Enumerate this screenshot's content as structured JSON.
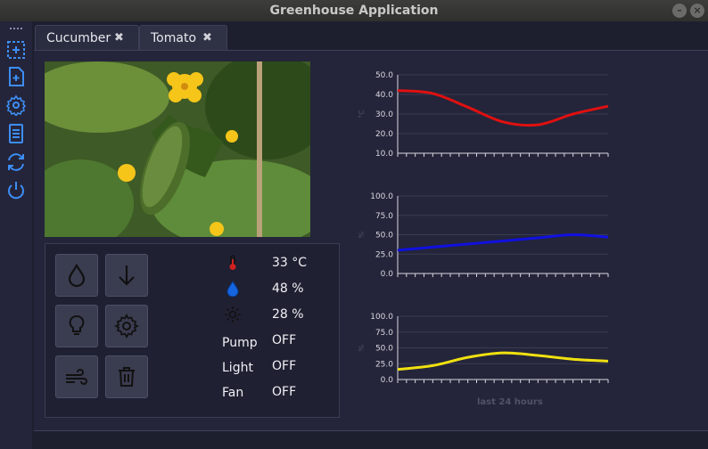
{
  "window": {
    "title": "Greenhouse Application",
    "minimize_glyph": "–",
    "close_glyph": "×"
  },
  "toolbar": {
    "items": [
      {
        "name": "select-area-icon"
      },
      {
        "name": "add-file-icon"
      },
      {
        "name": "settings-icon"
      },
      {
        "name": "document-icon"
      },
      {
        "name": "sync-icon"
      },
      {
        "name": "power-icon"
      }
    ],
    "icon_color": "#3d8ef5"
  },
  "tabs": [
    {
      "label": "Cucumber",
      "close": "✖"
    },
    {
      "label": "Tomato",
      "close": "✖"
    }
  ],
  "controls": {
    "buttons": [
      {
        "name": "water-drop-button",
        "icon": "water-drop-icon"
      },
      {
        "name": "down-arrow-button",
        "icon": "arrow-down-icon"
      },
      {
        "name": "light-bulb-button",
        "icon": "light-bulb-icon"
      },
      {
        "name": "settings-button",
        "icon": "gear-icon"
      },
      {
        "name": "fan-button",
        "icon": "wind-icon"
      },
      {
        "name": "delete-button",
        "icon": "trash-icon"
      }
    ]
  },
  "sensors": {
    "temperature": "33 °C",
    "humidity": "48 %",
    "light_level": "28 %"
  },
  "devices": {
    "pump_label": "Pump",
    "pump_state": "OFF",
    "light_label": "Light",
    "light_state": "OFF",
    "fan_label": "Fan",
    "fan_state": "OFF"
  },
  "chart_data": [
    {
      "type": "line",
      "ylabel": "°C",
      "ylim": [
        10.0,
        50.0
      ],
      "yticks": [
        "50.0",
        "40.0",
        "30.0",
        "20.0",
        "10.0"
      ],
      "x": [
        0,
        4,
        8,
        12,
        16,
        20,
        24
      ],
      "series": [
        {
          "values": [
            42.0,
            40.5,
            33.5,
            26.0,
            24.5,
            30.0,
            34.0
          ],
          "color": "#e01010"
        }
      ]
    },
    {
      "type": "line",
      "ylabel": "%",
      "ylim": [
        0.0,
        100.0
      ],
      "yticks": [
        "100.0",
        "75.0",
        "50.0",
        "25.0",
        "0.0"
      ],
      "x": [
        0,
        4,
        8,
        12,
        16,
        20,
        24
      ],
      "series": [
        {
          "values": [
            30,
            34,
            38,
            42,
            46,
            50,
            47
          ],
          "color": "#1010e0"
        }
      ]
    },
    {
      "type": "line",
      "ylabel": "%",
      "ylim": [
        0.0,
        100.0
      ],
      "yticks": [
        "100.0",
        "75.0",
        "50.0",
        "25.0",
        "0.0"
      ],
      "x": [
        0,
        4,
        8,
        12,
        16,
        20,
        24
      ],
      "xlabel": "last 24 hours",
      "series": [
        {
          "values": [
            16,
            22,
            35,
            42,
            38,
            32,
            29
          ],
          "color": "#f0e010"
        }
      ]
    }
  ]
}
